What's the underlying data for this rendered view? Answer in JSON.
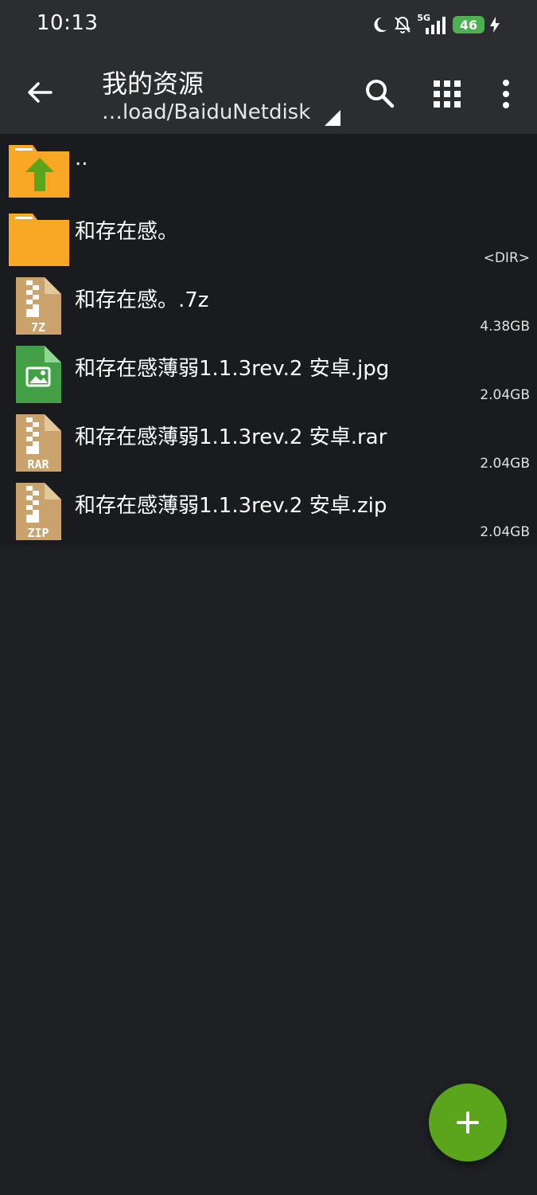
{
  "status_bar": {
    "time": "10:13",
    "network": "5G",
    "battery": "46"
  },
  "toolbar": {
    "title": "我的资源",
    "path": "…load/BaiduNetdisk",
    "icons": [
      "back-arrow-icon",
      "search-icon",
      "grid-icon",
      "more-vert-icon"
    ]
  },
  "files": [
    {
      "name": "..",
      "meta": "",
      "icon": "folder-up-icon"
    },
    {
      "name": "和存在感。",
      "meta": "<DIR>",
      "icon": "folder-icon"
    },
    {
      "name": "和存在感。.7z",
      "meta": "4.38GB",
      "icon": "archive-icon",
      "badge": "7Z"
    },
    {
      "name": "和存在感薄弱1.1.3rev.2 安卓.jpg",
      "meta": "2.04GB",
      "icon": "image-file-icon"
    },
    {
      "name": "和存在感薄弱1.1.3rev.2 安卓.rar",
      "meta": "2.04GB",
      "icon": "archive-icon",
      "badge": "RAR"
    },
    {
      "name": "和存在感薄弱1.1.3rev.2 安卓.zip",
      "meta": "2.04GB",
      "icon": "archive-icon",
      "badge": "ZIP"
    }
  ],
  "fab": {
    "icon": "plus-icon"
  },
  "colors": {
    "toolbar": "#2c2d31",
    "background": "#1f2024",
    "list": "#1a1b1f",
    "accent": "#5aa51b",
    "folder": "#f9a825",
    "archive": "#c9a36b",
    "image": "#43a047"
  }
}
